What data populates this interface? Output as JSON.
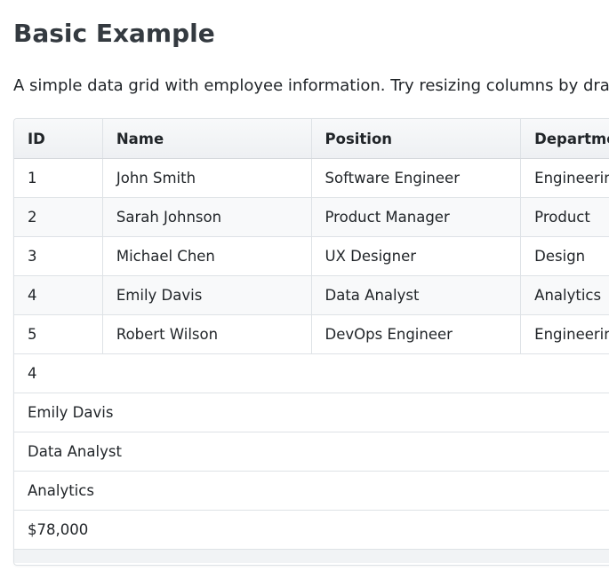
{
  "heading": "Basic Example",
  "description": "A simple data grid with employee information. Try resizing columns by dragg",
  "grid": {
    "columns": [
      "ID",
      "Name",
      "Position",
      "Departmen"
    ],
    "rows": [
      [
        "1",
        "John Smith",
        "Software Engineer",
        "Engineerin"
      ],
      [
        "2",
        "Sarah Johnson",
        "Product Manager",
        "Product"
      ],
      [
        "3",
        "Michael Chen",
        "UX Designer",
        "Design"
      ],
      [
        "4",
        "Emily Davis",
        "Data Analyst",
        "Analytics"
      ],
      [
        "5",
        "Robert Wilson",
        "DevOps Engineer",
        "Engineerin"
      ]
    ],
    "detail": [
      "4",
      "Emily Davis",
      "Data Analyst",
      "Analytics",
      "$78,000"
    ]
  }
}
